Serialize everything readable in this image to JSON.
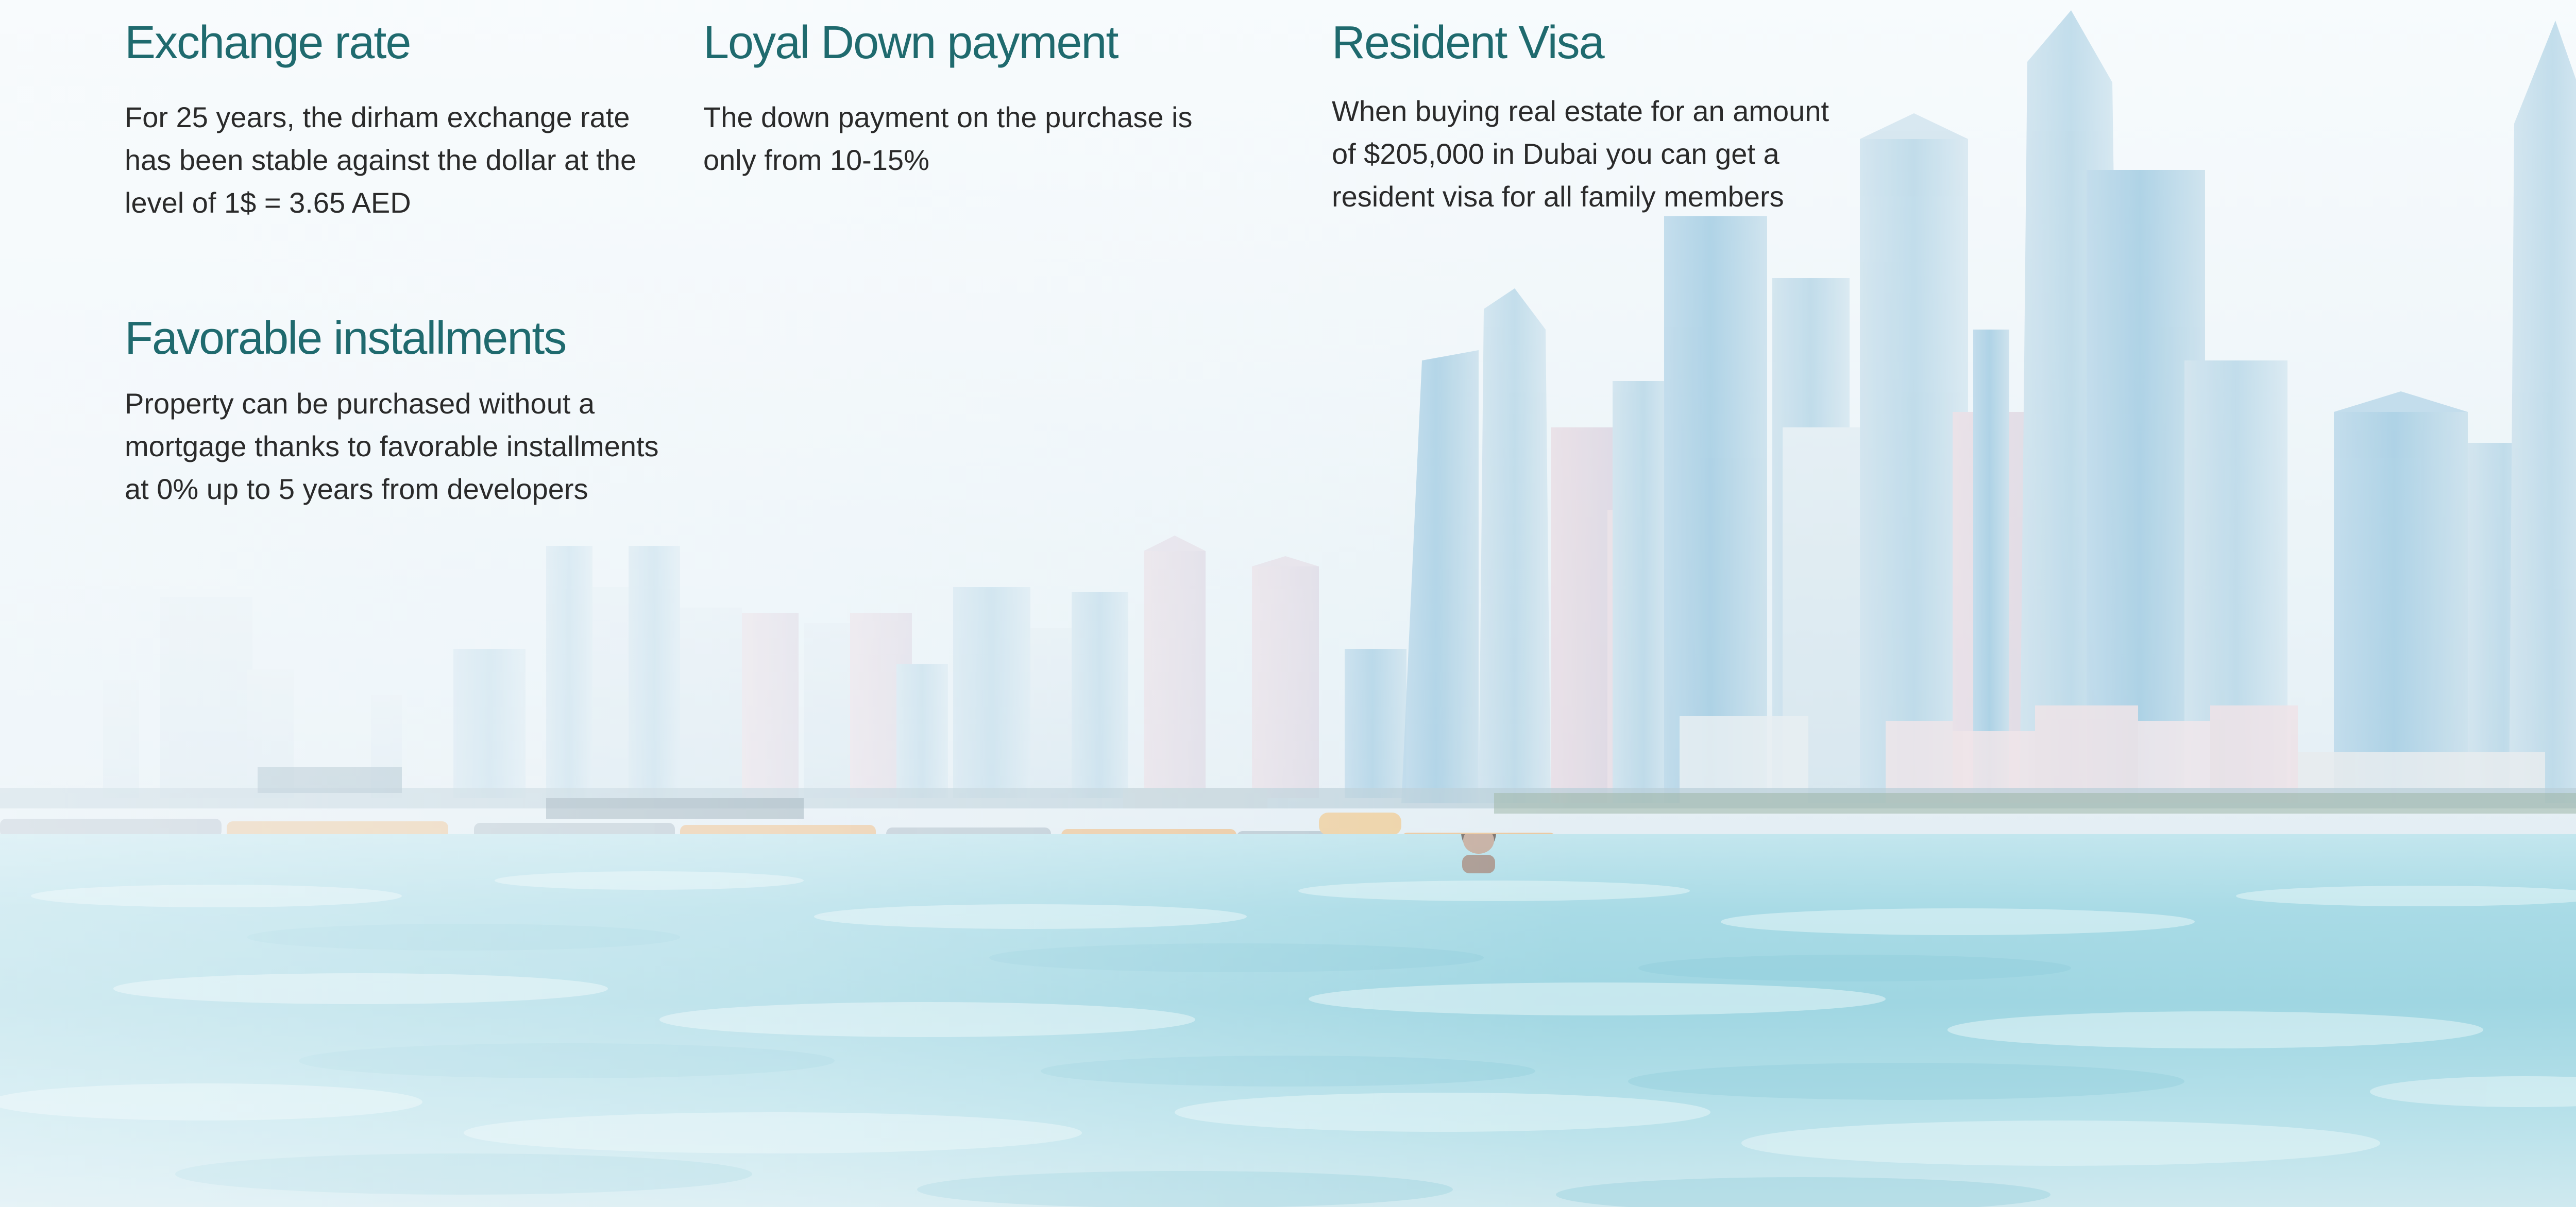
{
  "features": {
    "exchange_rate": {
      "title": "Exchange rate",
      "text": "For 25 years, the dirham exchange rate has been stable against the dollar at the level of 1$ = 3.65 AED"
    },
    "down_payment": {
      "title": "Loyal Down payment",
      "text": "The down payment on the purchase is only from 10-15%"
    },
    "resident_visa": {
      "title": "Resident Visa",
      "text": "When buying real estate for an amount of $205,000 in Dubai you can get a resident visa for all family members"
    },
    "installments": {
      "title": "Favorable installments",
      "text": "Property can be purchased without a mortgage thanks to favorable installments at 0% up to 5 years from developers"
    }
  },
  "colors": {
    "heading": "#1f6a6e",
    "body_text": "#2a2a2a",
    "sky": "#f2f8fb",
    "water": "#a9dbe6"
  }
}
